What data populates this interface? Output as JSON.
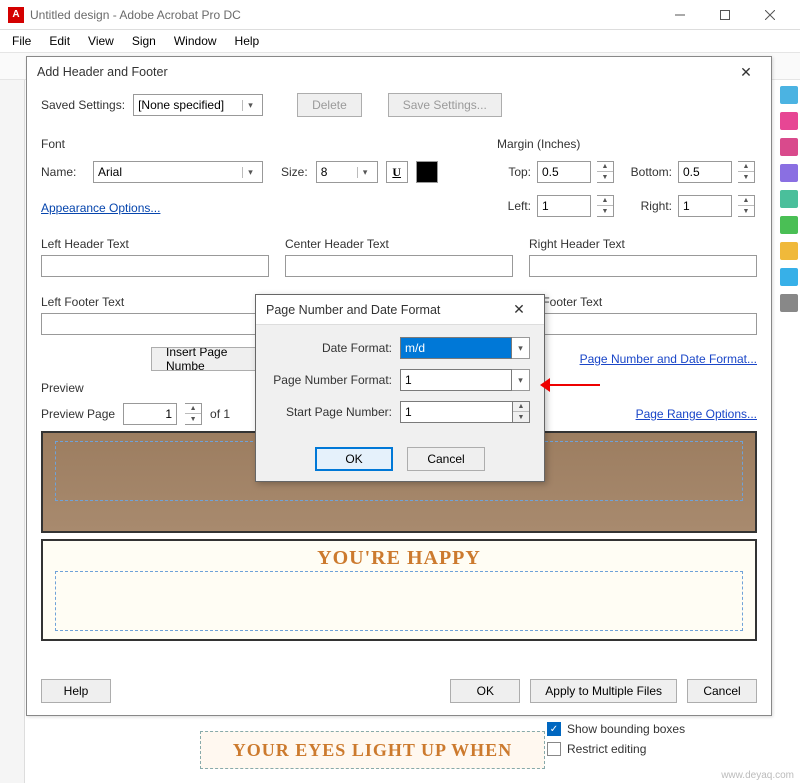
{
  "window": {
    "title": "Untitled design - Adobe Acrobat Pro DC",
    "menu": {
      "file": "File",
      "edit": "Edit",
      "view": "View",
      "sign": "Sign",
      "window": "Window",
      "help": "Help"
    }
  },
  "dialog": {
    "title": "Add Header and Footer",
    "savedSettingsLabel": "Saved Settings:",
    "savedSettingsValue": "[None specified]",
    "deleteBtn": "Delete",
    "saveSettingsBtn": "Save Settings...",
    "fontGroup": "Font",
    "nameLabel": "Name:",
    "nameValue": "Arial",
    "sizeLabel": "Size:",
    "sizeValue": "8",
    "appearanceLink": "Appearance Options...",
    "marginGroup": "Margin (Inches)",
    "topLabel": "Top:",
    "topValue": "0.5",
    "bottomLabel": "Bottom:",
    "bottomValue": "0.5",
    "leftLabel": "Left:",
    "leftValue": "1",
    "rightLabel": "Right:",
    "rightValue": "1",
    "lhLabel": "Left Header Text",
    "chLabel": "Center Header Text",
    "rhLabel": "Right Header Text",
    "lfLabel": "Left Footer Text",
    "rfLabel": "ht Footer Text",
    "insertPageBtn": "Insert Page Numbe",
    "pnDateLink": "Page Number and Date Format...",
    "previewLabel": "Preview",
    "previewPageLabel": "Preview Page",
    "previewPageValue": "1",
    "ofLabel": "of 1",
    "pageRangeLink": "Page Range Options...",
    "previewBottomText": "YOU'RE HAPPY",
    "helpBtn": "Help",
    "okBtn": "OK",
    "applyBtn": "Apply to Multiple Files",
    "cancelBtn": "Cancel"
  },
  "subdialog": {
    "title": "Page Number and Date Format",
    "dateFormatLabel": "Date Format:",
    "dateFormatValue": "m/d",
    "pageFormatLabel": "Page Number Format:",
    "pageFormatValue": "1",
    "startPageLabel": "Start Page Number:",
    "startPageValue": "1",
    "okBtn": "OK",
    "cancelBtn": "Cancel"
  },
  "sidePanel": {
    "showBounding": "Show bounding boxes",
    "restrictEditing": "Restrict editing"
  },
  "docStrip": "YOUR EYES LIGHT UP WHEN",
  "watermark": "www.deyaq.com"
}
